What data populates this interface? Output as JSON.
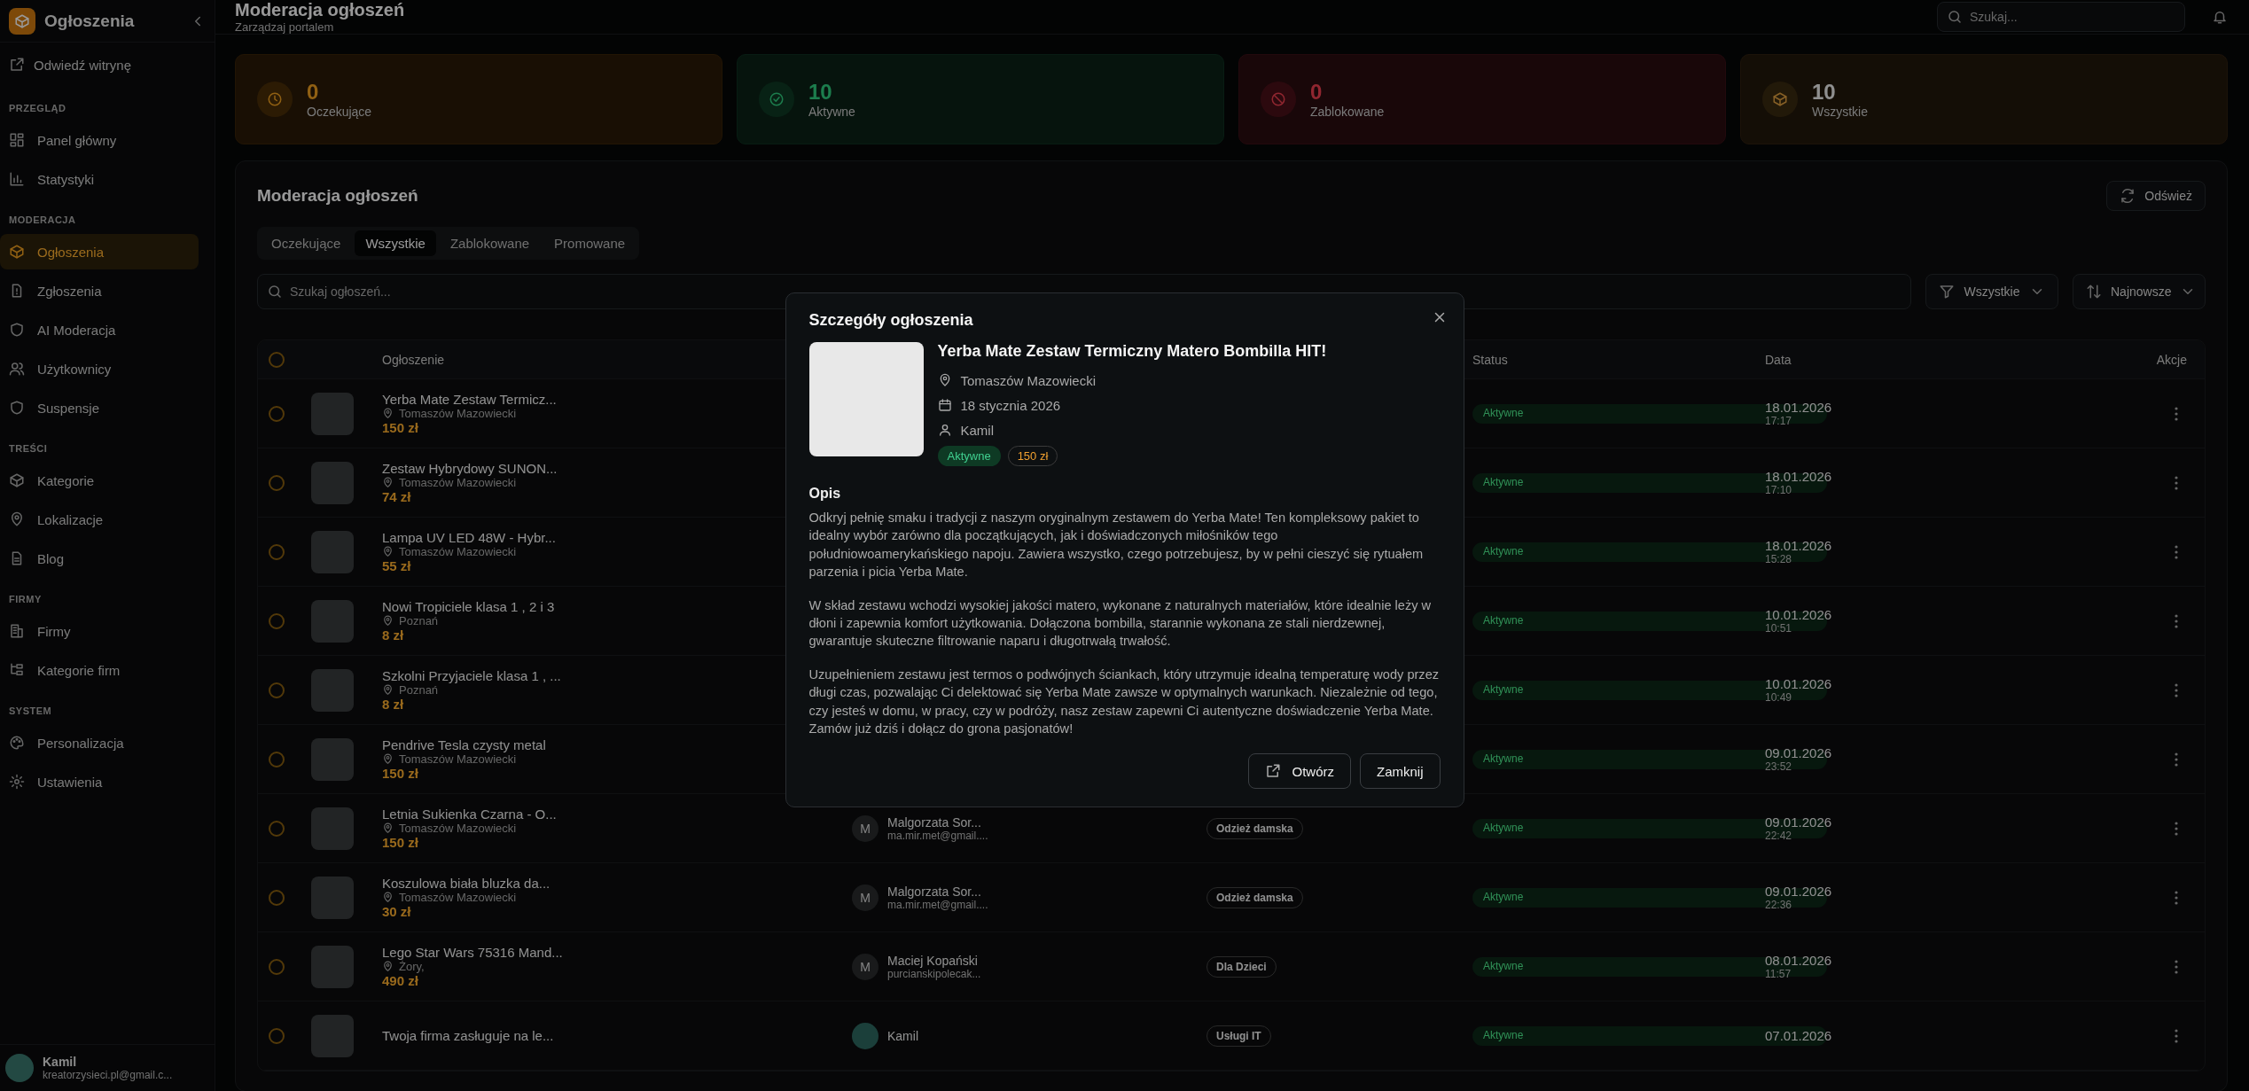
{
  "sidebar": {
    "brand": "Ogłoszenia",
    "visit_link": "Odwiedź witrynę",
    "sections": [
      {
        "title": "PRZEGLĄD",
        "items": [
          {
            "label": "Panel główny",
            "selected": false
          },
          {
            "label": "Statystyki",
            "selected": false
          }
        ]
      },
      {
        "title": "MODERACJA",
        "items": [
          {
            "label": "Ogłoszenia",
            "selected": true
          },
          {
            "label": "Zgłoszenia",
            "selected": false
          },
          {
            "label": "AI Moderacja",
            "selected": false
          },
          {
            "label": "Użytkownicy",
            "selected": false
          },
          {
            "label": "Suspensje",
            "selected": false
          }
        ]
      },
      {
        "title": "TREŚCI",
        "items": [
          {
            "label": "Kategorie",
            "selected": false
          },
          {
            "label": "Lokalizacje",
            "selected": false
          },
          {
            "label": "Blog",
            "selected": false
          }
        ]
      },
      {
        "title": "FIRMY",
        "items": [
          {
            "label": "Firmy",
            "selected": false
          },
          {
            "label": "Kategorie firm",
            "selected": false
          }
        ]
      },
      {
        "title": "SYSTEM",
        "items": [
          {
            "label": "Personalizacja",
            "selected": false
          },
          {
            "label": "Ustawienia",
            "selected": false
          }
        ]
      }
    ],
    "user": {
      "name": "Kamil",
      "email": "kreatorzysieci.pl@gmail.c..."
    }
  },
  "header": {
    "title": "Moderacja ogłoszeń",
    "subtitle": "Zarządzaj portalem",
    "search": {
      "placeholder": "Szukaj..."
    }
  },
  "stats": [
    {
      "kind": "pending",
      "value": "0",
      "label": "Oczekujące"
    },
    {
      "kind": "active",
      "value": "10",
      "label": "Aktywne"
    },
    {
      "kind": "blocked",
      "value": "0",
      "label": "Zablokowane"
    },
    {
      "kind": "all",
      "value": "10",
      "label": "Wszystkie"
    }
  ],
  "moderation": {
    "title": "Moderacja ogłoszeń",
    "refresh": "Odśwież",
    "tabs": [
      {
        "label": "Oczekujące",
        "selected": false
      },
      {
        "label": "Wszystkie",
        "selected": true
      },
      {
        "label": "Zablokowane",
        "selected": false
      },
      {
        "label": "Promowane",
        "selected": false
      }
    ],
    "search": {
      "placeholder": "Szukaj ogłoszeń..."
    },
    "filter": "Wszystkie",
    "sort": "Najnowsze",
    "table": {
      "header_checked": false,
      "columns": [
        "Ogłoszenie",
        "Status",
        "Data",
        "Akcje"
      ],
      "rows": [
        {
          "checked": false,
          "title": "Yerba Mate Zestaw Termicz...",
          "location": "Tomaszów Mazowiecki",
          "price": "150 zł",
          "status": "Aktywne",
          "date": "18.01.2026",
          "time": "17:17"
        },
        {
          "checked": false,
          "title": "Zestaw Hybrydowy SUNON...",
          "location": "Tomaszów Mazowiecki",
          "price": "74 zł",
          "status": "Aktywne",
          "date": "18.01.2026",
          "time": "17:10"
        },
        {
          "checked": false,
          "title": "Lampa UV LED 48W - Hybr...",
          "location": "Tomaszów Mazowiecki",
          "price": "55 zł",
          "status": "Aktywne",
          "date": "18.01.2026",
          "time": "15:28"
        },
        {
          "checked": false,
          "title": "Nowi Tropiciele klasa 1 , 2 i 3",
          "location": "Poznań",
          "price": "8 zł",
          "status": "Aktywne",
          "date": "10.01.2026",
          "time": "10:51"
        },
        {
          "checked": false,
          "title": "Szkolni Przyjaciele klasa 1 , ...",
          "location": "Poznań",
          "price": "8 zł",
          "status": "Aktywne",
          "date": "10.01.2026",
          "time": "10:49"
        },
        {
          "checked": false,
          "title": "Pendrive Tesla czysty metal",
          "location": "Tomaszów Mazowiecki",
          "price": "150 zł",
          "status": "Aktywne",
          "date": "09.01.2026",
          "time": "23:52"
        },
        {
          "checked": false,
          "title": "Letnia Sukienka Czarna - O...",
          "location": "Tomaszów Mazowiecki",
          "price": "150 zł",
          "initial": "M",
          "user": "Malgorzata Sor...",
          "email": "ma.mir.met@gmail....",
          "category": "Odzież damska",
          "status": "Aktywne",
          "date": "09.01.2026",
          "time": "22:42"
        },
        {
          "checked": false,
          "title": "Koszulowa biała bluzka da...",
          "location": "Tomaszów Mazowiecki",
          "price": "30 zł",
          "initial": "M",
          "user": "Malgorzata Sor...",
          "email": "ma.mir.met@gmail....",
          "category": "Odzież damska",
          "status": "Aktywne",
          "date": "09.01.2026",
          "time": "22:36"
        },
        {
          "checked": false,
          "title": "Lego Star Wars 75316 Mand...",
          "location": "Żory,",
          "price": "490 zł",
          "initial": "M",
          "user": "Maciej Kopański",
          "email": "purcianskipolecak...",
          "category": "Dla Dzieci",
          "status": "Aktywne",
          "date": "08.01.2026",
          "time": "11:57"
        },
        {
          "checked": false,
          "title": "Twoja firma zasługuje na le...",
          "user": "Kamil",
          "category": "Usługi IT",
          "status": "Aktywne",
          "date": "07.01.2026"
        }
      ]
    }
  },
  "modal": {
    "title": "Szczegóły ogłoszenia",
    "listing": {
      "title": "Yerba Mate Zestaw Termiczny Matero Bombilla HIT!",
      "location": "Tomaszów Mazowiecki",
      "date": "18 stycznia 2026",
      "author": "Kamil",
      "status": "Aktywne",
      "price": "150 zł"
    },
    "description_heading": "Opis",
    "paragraphs": [
      "Odkryj pełnię smaku i tradycji z naszym oryginalnym zestawem do Yerba Mate! Ten kompleksowy pakiet to idealny wybór zarówno dla początkujących, jak i doświadczonych miłośników tego południowoamerykańskiego napoju. Zawiera wszystko, czego potrzebujesz, by w pełni cieszyć się rytuałem parzenia i picia Yerba Mate.",
      "W skład zestawu wchodzi wysokiej jakości matero, wykonane z naturalnych materiałów, które idealnie leży w dłoni i zapewnia komfort użytkowania. Dołączona bombilla, starannie wykonana ze stali nierdzewnej, gwarantuje skuteczne filtrowanie naparu i długotrwałą trwałość.",
      "Uzupełnieniem zestawu jest termos o podwójnych ściankach, który utrzymuje idealną temperaturę wody przez długi czas, pozwalając Ci delektować się Yerba Mate zawsze w optymalnych warunkach. Niezależnie od tego, czy jesteś w domu, w pracy, czy w podróży, nasz zestaw zapewni Ci autentyczne doświadczenie Yerba Mate. Zamów już dziś i dołącz do grona pasjonatów!"
    ],
    "open_button": "Otwórz",
    "close_button": "Zamknij"
  }
}
